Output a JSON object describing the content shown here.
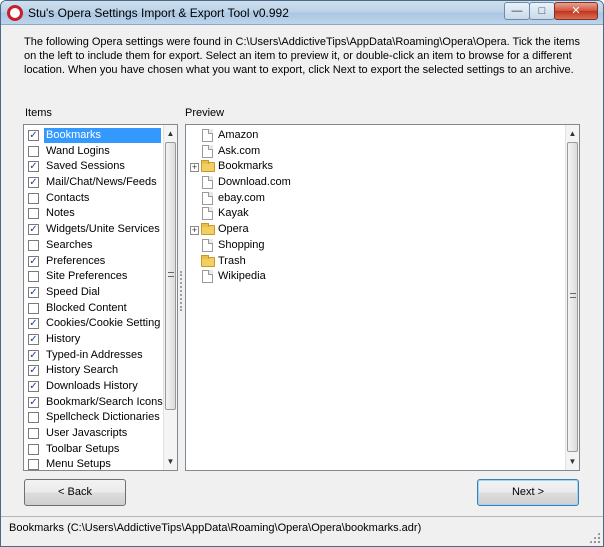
{
  "window": {
    "title": "Stu's Opera Settings Import & Export Tool v0.992",
    "min_glyph": "—",
    "max_glyph": "□",
    "close_glyph": "✕"
  },
  "description": "The following Opera settings were found in C:\\Users\\AddictiveTips\\AppData\\Roaming\\Opera\\Opera. Tick the items on the left to include them for export. Select an item to preview it, or double-click an item to browse for a different location. When you have chosen what you want to export, click Next to export the selected settings to an archive.",
  "items_label": "Items",
  "preview_label": "Preview",
  "items": [
    {
      "label": "Bookmarks",
      "checked": true,
      "selected": true
    },
    {
      "label": "Wand Logins",
      "checked": false
    },
    {
      "label": "Saved Sessions",
      "checked": true
    },
    {
      "label": "Mail/Chat/News/Feeds",
      "checked": true
    },
    {
      "label": "Contacts",
      "checked": false
    },
    {
      "label": "Notes",
      "checked": false
    },
    {
      "label": "Widgets/Unite Services",
      "checked": true
    },
    {
      "label": "Searches",
      "checked": false
    },
    {
      "label": "Preferences",
      "checked": true
    },
    {
      "label": "Site Preferences",
      "checked": false
    },
    {
      "label": "Speed Dial",
      "checked": true
    },
    {
      "label": "Blocked Content",
      "checked": false
    },
    {
      "label": "Cookies/Cookie Setting",
      "checked": true
    },
    {
      "label": "History",
      "checked": true
    },
    {
      "label": "Typed-in Addresses",
      "checked": true
    },
    {
      "label": "History Search",
      "checked": true
    },
    {
      "label": "Downloads History",
      "checked": true
    },
    {
      "label": "Bookmark/Search Icons",
      "checked": true
    },
    {
      "label": "Spellcheck Dictionaries",
      "checked": false
    },
    {
      "label": "User Javascripts",
      "checked": false
    },
    {
      "label": "Toolbar Setups",
      "checked": false
    },
    {
      "label": "Menu Setups",
      "checked": false
    }
  ],
  "preview_tree": [
    {
      "label": "Amazon",
      "type": "page",
      "expandable": false
    },
    {
      "label": "Ask.com",
      "type": "page",
      "expandable": false
    },
    {
      "label": "Bookmarks",
      "type": "folder",
      "expandable": true
    },
    {
      "label": "Download.com",
      "type": "page",
      "expandable": false
    },
    {
      "label": "ebay.com",
      "type": "page",
      "expandable": false
    },
    {
      "label": "Kayak",
      "type": "page",
      "expandable": false
    },
    {
      "label": "Opera",
      "type": "folder",
      "expandable": true
    },
    {
      "label": "Shopping",
      "type": "page",
      "expandable": false
    },
    {
      "label": "Trash",
      "type": "folder",
      "expandable": false
    },
    {
      "label": "Wikipedia",
      "type": "page",
      "expandable": false
    }
  ],
  "buttons": {
    "back": "< Back",
    "next": "Next >"
  },
  "status": "Bookmarks (C:\\Users\\AddictiveTips\\AppData\\Roaming\\Opera\\Opera\\bookmarks.adr)",
  "icons": {
    "checkmark": "✓",
    "expand": "+",
    "scroll_up": "▲",
    "scroll_down": "▼"
  }
}
